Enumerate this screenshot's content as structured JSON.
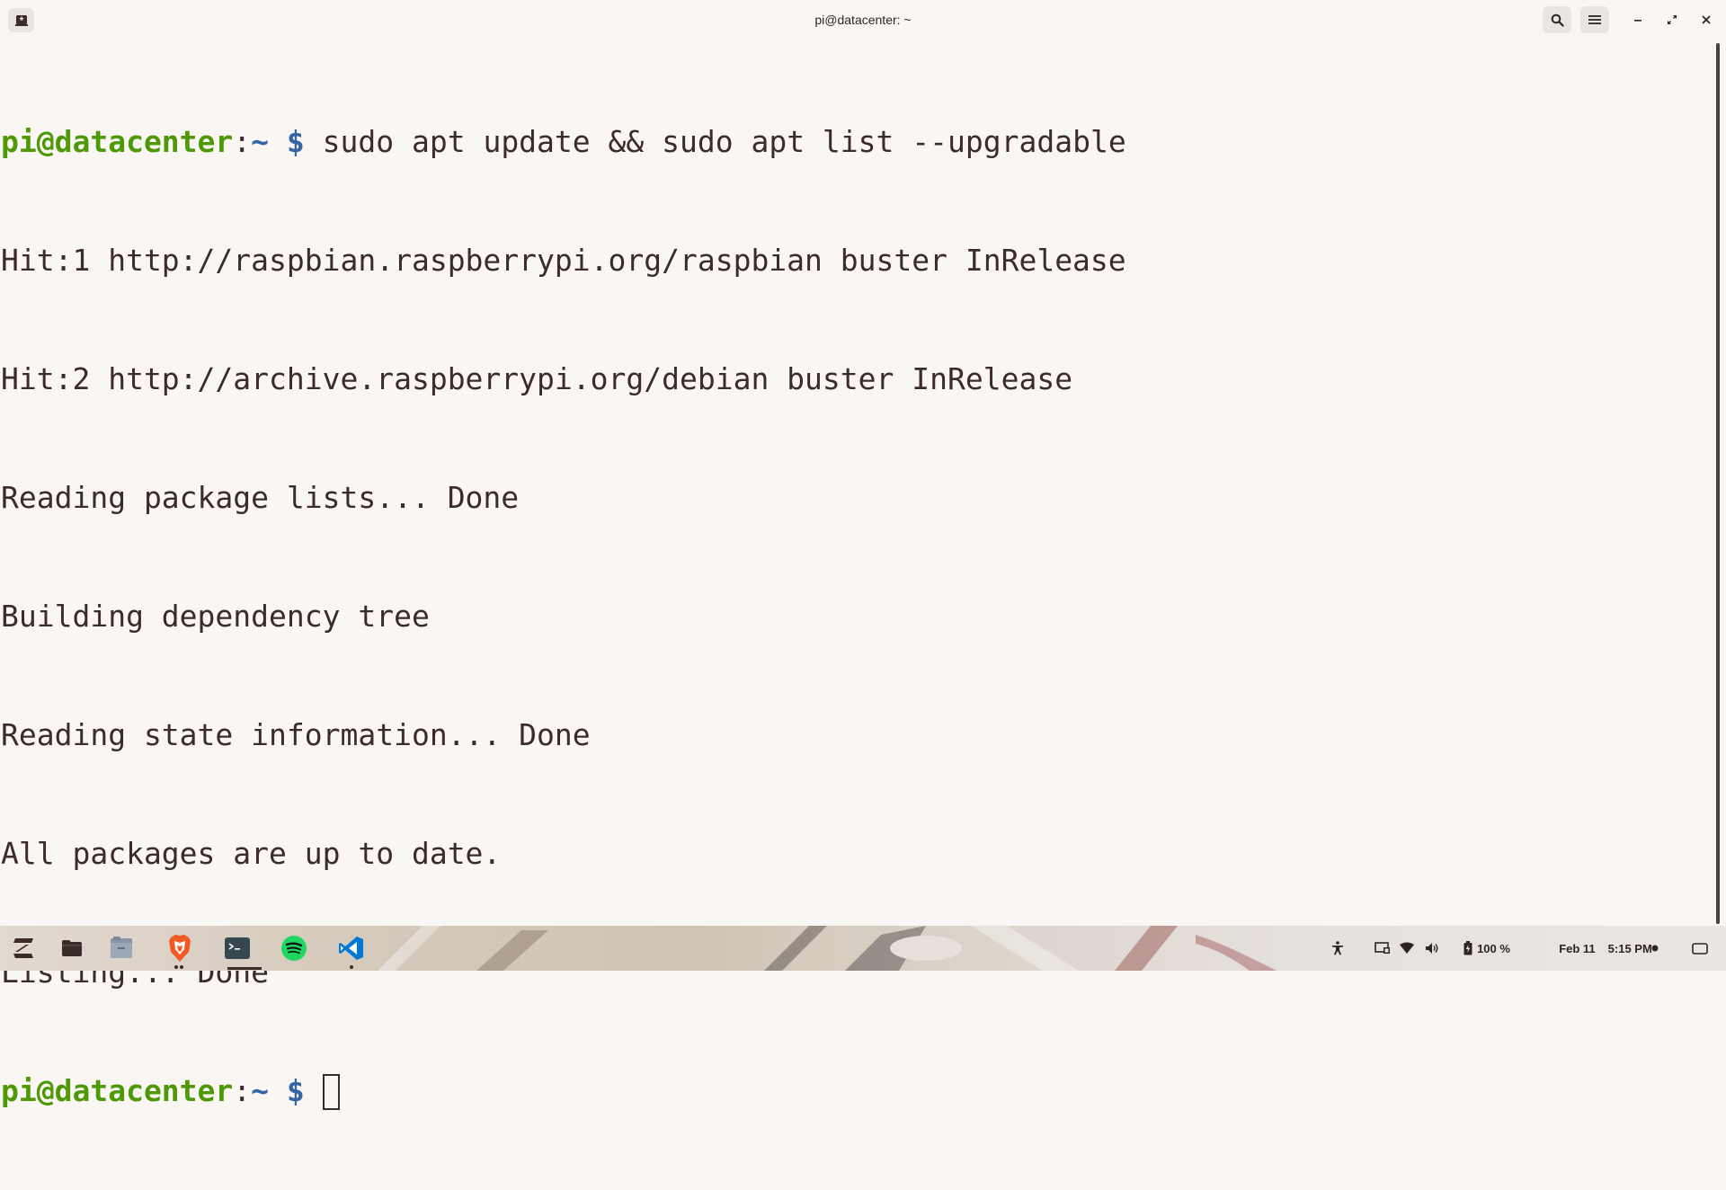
{
  "window": {
    "title": "pi@datacenter: ~"
  },
  "titlebar": {
    "new_tab_icon": "new-tab-icon",
    "search_icon": "search-icon",
    "menu_icon": "hamburger-menu-icon",
    "minimize_icon": "minimize-icon",
    "maximize_icon": "restore-icon",
    "close_icon": "close-icon"
  },
  "terminal": {
    "prompt": {
      "user_host": "pi@datacenter",
      "colon": ":",
      "path": "~",
      "dollar": " $ "
    },
    "command": "sudo apt update && sudo apt list --upgradable",
    "output": [
      "Hit:1 http://raspbian.raspberrypi.org/raspbian buster InRelease",
      "Hit:2 http://archive.raspberrypi.org/debian buster InRelease",
      "Reading package lists... Done",
      "Building dependency tree",
      "Reading state information... Done",
      "All packages are up to date.",
      "Listing... Done"
    ],
    "colors": {
      "user_host": "#4e9a06",
      "path": "#3465a4",
      "text": "#3b2c27",
      "background": "#faf6f4"
    }
  },
  "taskbar": {
    "apps": [
      {
        "name": "Zorin menu",
        "icon": "zorin-menu-icon"
      },
      {
        "name": "Files",
        "icon": "folder-icon"
      },
      {
        "name": "Files manager",
        "icon": "file-manager-icon"
      },
      {
        "name": "Brave",
        "icon": "brave-browser-icon"
      },
      {
        "name": "Terminal",
        "icon": "terminal-icon"
      },
      {
        "name": "Spotify",
        "icon": "spotify-icon"
      },
      {
        "name": "Visual Studio Code",
        "icon": "vscode-icon"
      }
    ],
    "tray": {
      "accessibility_icon": "accessibility-icon",
      "display_icon": "screen-share-icon",
      "network_icon": "wifi-icon",
      "volume_icon": "volume-icon",
      "battery_icon": "battery-icon",
      "battery_level": "100 %",
      "date": "Feb 11",
      "time": "5:15 PM",
      "notification_icon": "notification-dot-icon",
      "desktop_icon": "show-desktop-icon"
    }
  }
}
